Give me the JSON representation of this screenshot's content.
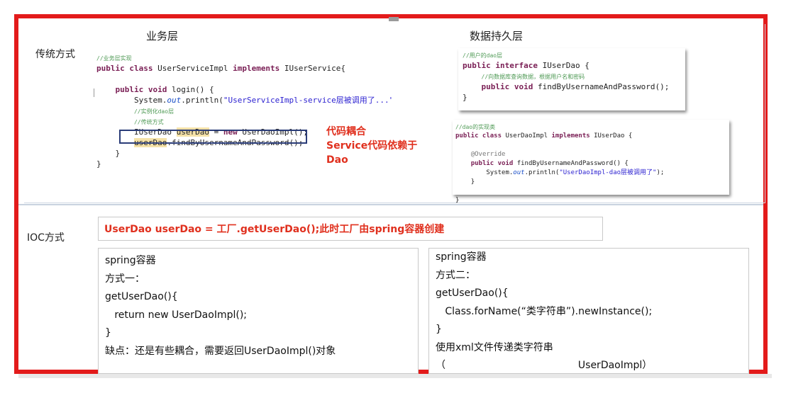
{
  "labels": {
    "business_layer": "业务层",
    "data_layer": "数据持久层",
    "traditional": "传统方式",
    "ioc": "IOC方式"
  },
  "service_code": {
    "comment_top": "//业务层实现",
    "class_decl_kw": "public class",
    "class_decl_name": " UserServiceImpl ",
    "class_decl_kw2": "implements",
    "class_decl_rest": " IUserService{",
    "method_kw": "public void",
    "method_rest": " login() {",
    "println_a": "System.",
    "println_b": "out",
    "println_c": ".println(",
    "println_str": "\"UserServiceImpl-service层被调用了...\"",
    "println_d": ");",
    "comment_inst": "//实例化dao层",
    "comment_trad": "//传统方式",
    "stmt_a": "IUserDao ",
    "stmt_b": "userDao",
    "stmt_c": " = ",
    "stmt_kw": "new",
    "stmt_d": " UserDaoImpl();",
    "call_a": "userDao",
    "call_b": ".findByUsernameAndPassword();",
    "close_inner": "}",
    "close_outer": "}"
  },
  "red_note": {
    "line1": "代码耦合",
    "line2": "Service代码依赖于",
    "line3": "Dao"
  },
  "interface_code": {
    "comment": "//用户的dao层",
    "decl_kw": "public interface",
    "decl_rest": " IUserDao {",
    "comment2": "//向数据库查询数据，根据用户名和密码",
    "method_kw": "public void",
    "method_rest": " findByUsernameAndPassword();",
    "close": "}"
  },
  "impl_code": {
    "comment": "//dao的实现类",
    "decl_kw": "public class",
    "decl_rest": " UserDaoImpl ",
    "decl_kw2": "implements",
    "decl_rest2": " IUserDao {",
    "override": "@Override",
    "method_kw": "public void",
    "method_rest": " findByUsernameAndPassword() {",
    "println_a": "System.",
    "println_b": "out",
    "println_c": ".println(",
    "println_str": "\"UserDaoImpl-dao层被调用了\"",
    "println_d": ");",
    "close_inner": "}",
    "close_outer": "}"
  },
  "ioc": {
    "factory_statement": "UserDao userDao = 工厂.getUserDao();此时工厂由spring容器创建",
    "left_panel": [
      "spring容器",
      "方式一：",
      "getUserDao(){",
      "   return new UserDaoImpl();",
      "}",
      "缺点：还是有些耦合，需要返回UserDaoImpl()对象"
    ],
    "right_panel": [
      "spring容器",
      "方式二：",
      "getUserDao(){",
      "   Class.forName(“类字符串”).newInstance();",
      "}",
      "使用xml文件传递类字符串",
      "（                                          UserDaoImpl）"
    ]
  },
  "colors": {
    "frame": "#e31b1b",
    "note_red": "#e0301e",
    "keyword": "#7a1f55",
    "string": "#2a1fd0",
    "comment": "#4f9a55"
  }
}
